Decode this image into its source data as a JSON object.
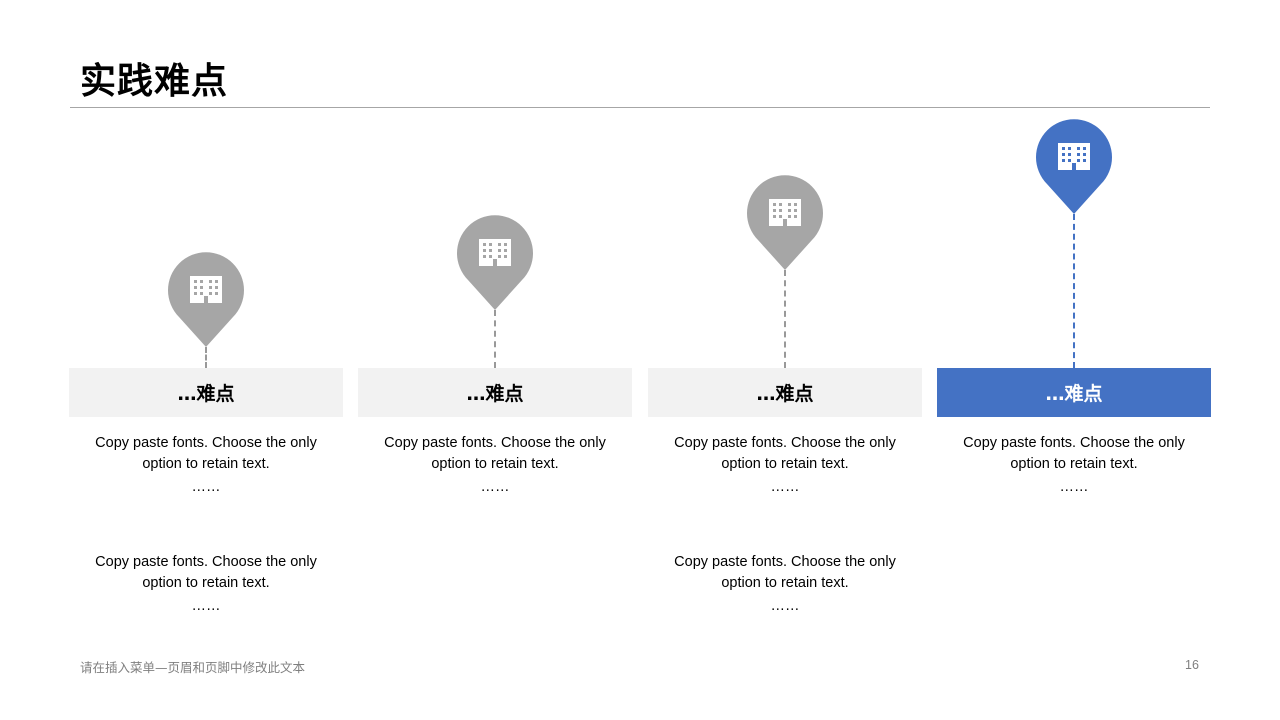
{
  "title": "实践难点",
  "columns": [
    {
      "heading": "…难点",
      "icon": "building-icon",
      "items": [
        {
          "line1": "Copy paste fonts. Choose the only",
          "line2": "option to retain text.",
          "ellipsis": "……"
        },
        {
          "line1": "Copy paste fonts. Choose the only",
          "line2": "option to retain text.",
          "ellipsis": "……"
        }
      ]
    },
    {
      "heading": "…难点",
      "icon": "building-icon",
      "items": [
        {
          "line1": "Copy paste fonts. Choose the only",
          "line2": "option to retain text.",
          "ellipsis": "……"
        }
      ]
    },
    {
      "heading": "…难点",
      "icon": "building-icon",
      "items": [
        {
          "line1": "Copy paste fonts. Choose the only",
          "line2": "option to retain text.",
          "ellipsis": "……"
        },
        {
          "line1": "Copy paste fonts. Choose the only",
          "line2": "option to retain text.",
          "ellipsis": "……"
        }
      ]
    },
    {
      "heading": "…难点",
      "icon": "building-icon",
      "highlighted": true,
      "items": [
        {
          "line1": "Copy paste fonts. Choose the only",
          "line2": "option to retain text.",
          "ellipsis": "……"
        }
      ]
    }
  ],
  "footer": {
    "text": "请在插入菜单—页眉和页脚中修改此文本",
    "page": "16"
  },
  "colors": {
    "accent": "#4472c4",
    "pin_gray": "#a6a6a6",
    "label_bg": "#f2f2f2",
    "rule": "#a6a6a6"
  }
}
